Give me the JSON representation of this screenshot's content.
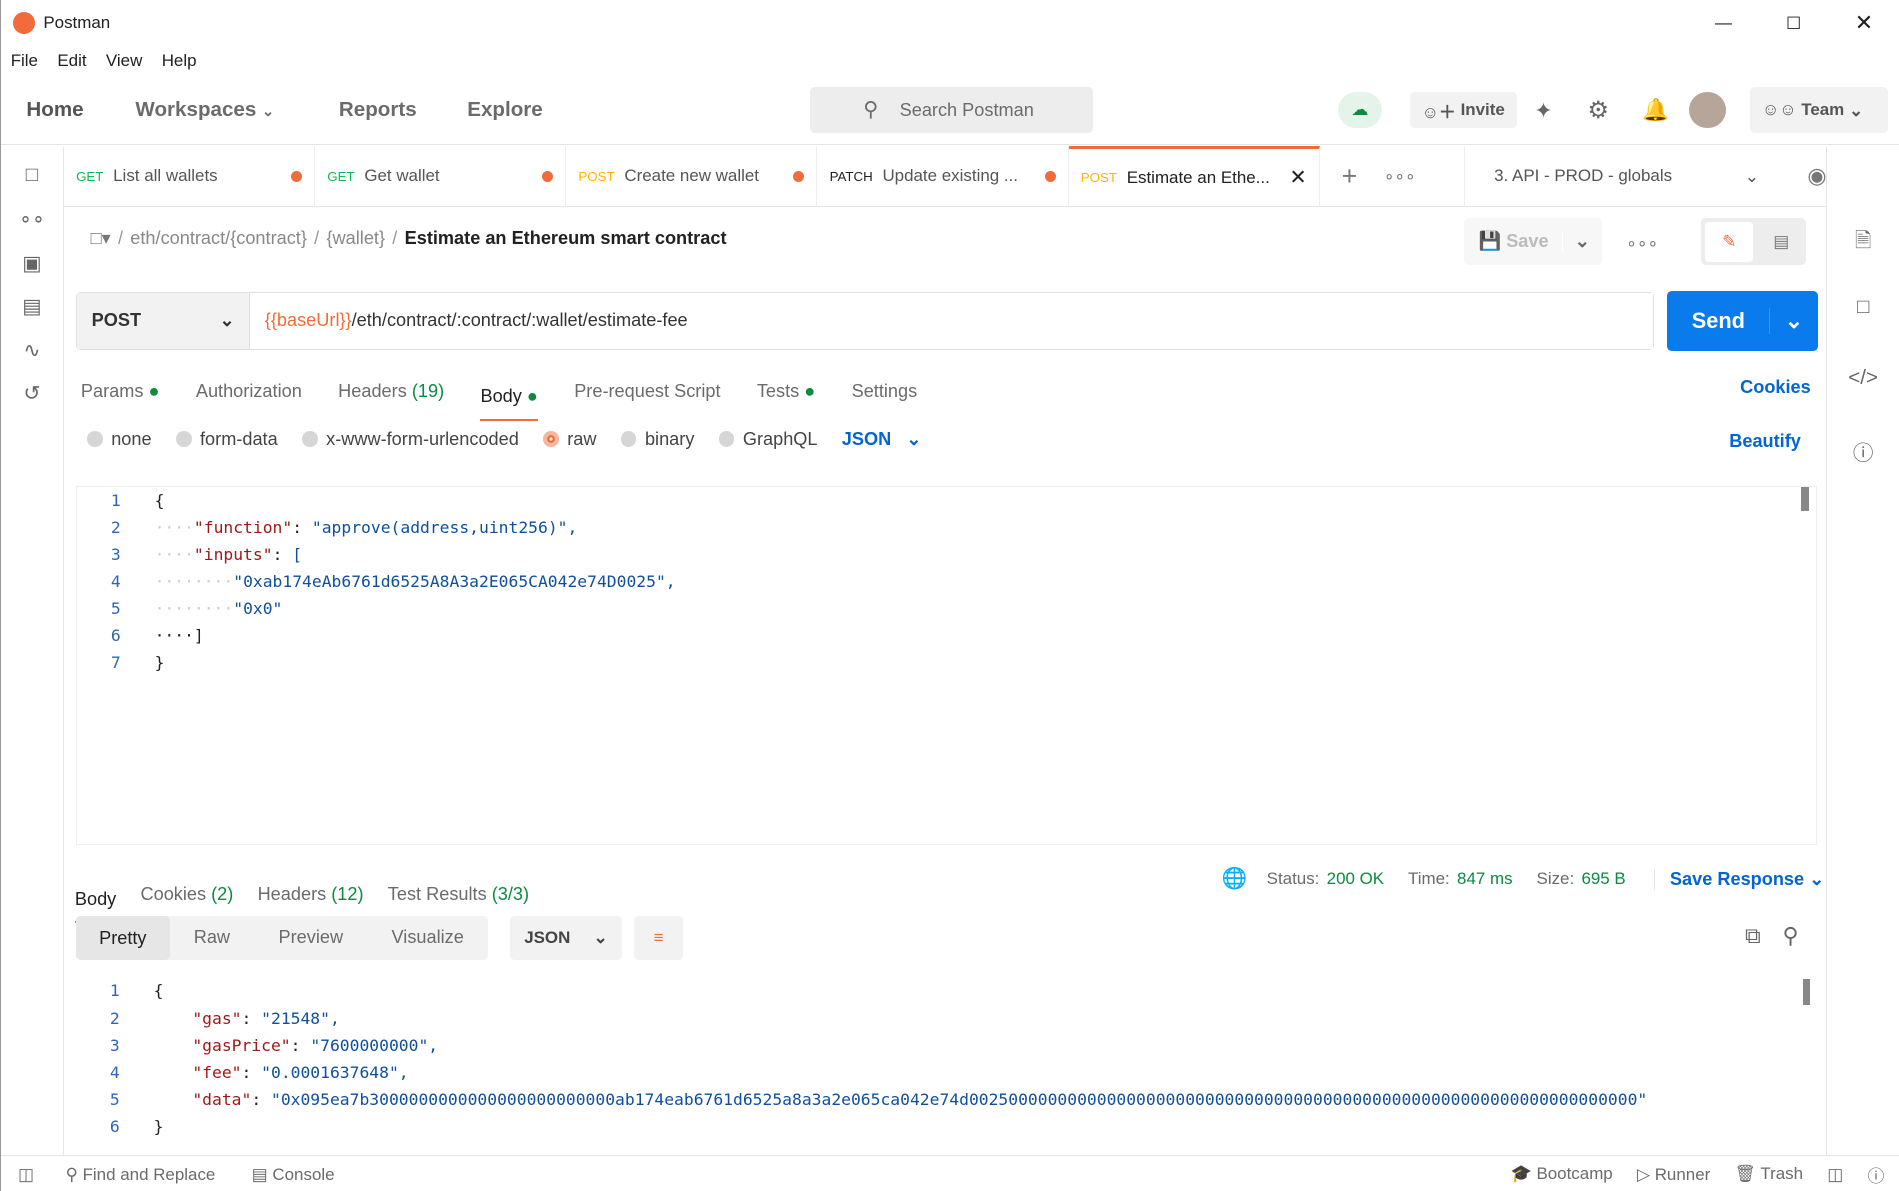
{
  "window": {
    "title": "Postman"
  },
  "menu": [
    "File",
    "Edit",
    "View",
    "Help"
  ],
  "header": {
    "nav": [
      "Home",
      "Workspaces",
      "Reports",
      "Explore"
    ],
    "search_placeholder": "Search Postman",
    "invite": "Invite",
    "team": "Team"
  },
  "tabs": [
    {
      "method": "GET",
      "label": "List all wallets"
    },
    {
      "method": "GET",
      "label": "Get wallet"
    },
    {
      "method": "POST",
      "label": "Create new wallet"
    },
    {
      "method": "PATCH",
      "label": "Update existing ..."
    },
    {
      "method": "POST",
      "label": "Estimate an Ethe..."
    }
  ],
  "environment": "3. API - PROD - globals",
  "breadcrumb": {
    "p1": "eth/contract/{contract}",
    "p2": "{wallet}",
    "current": "Estimate an Ethereum smart contract",
    "sep": "/"
  },
  "toolbar": {
    "save": "Save"
  },
  "request": {
    "method": "POST",
    "url_var": "{{baseUrl}}",
    "url_path": "/eth/contract/:contract/:wallet/estimate-fee",
    "send": "Send"
  },
  "req_tabs": {
    "params": "Params",
    "authorization": "Authorization",
    "headers": "Headers",
    "headers_count": "(19)",
    "body": "Body",
    "prerequest": "Pre-request Script",
    "tests": "Tests",
    "settings": "Settings",
    "cookies": "Cookies"
  },
  "body_types": {
    "none": "none",
    "form_data": "form-data",
    "urlencoded": "x-www-form-urlencoded",
    "raw": "raw",
    "binary": "binary",
    "graphql": "GraphQL",
    "format": "JSON",
    "beautify": "Beautify"
  },
  "request_body": [
    {
      "n": "1",
      "t": "{"
    },
    {
      "n": "2",
      "k": "\"function\"",
      "v": "\"approve(address,uint256)\",",
      "i": "····"
    },
    {
      "n": "3",
      "k": "\"inputs\"",
      "v": "[",
      "i": "····"
    },
    {
      "n": "4",
      "v": "\"0xab174eAb6761d6525A8A3a2E065CA042e74D0025\",",
      "i": "········"
    },
    {
      "n": "5",
      "v": "\"0x0\"",
      "i": "········"
    },
    {
      "n": "6",
      "t": "····]"
    },
    {
      "n": "7",
      "t": "}"
    }
  ],
  "response": {
    "tabs": {
      "body": "Body",
      "cookies": "Cookies",
      "cookies_count": "(2)",
      "headers": "Headers",
      "headers_count": "(12)",
      "tests": "Test Results",
      "tests_count": "(3/3)"
    },
    "status_label": "Status:",
    "status": "200 OK",
    "time_label": "Time:",
    "time": "847 ms",
    "size_label": "Size:",
    "size": "695 B",
    "save": "Save Response",
    "views": [
      "Pretty",
      "Raw",
      "Preview",
      "Visualize"
    ],
    "format": "JSON",
    "body": [
      {
        "n": "1",
        "t": "{"
      },
      {
        "n": "2",
        "k": "\"gas\"",
        "v": "\"21548\","
      },
      {
        "n": "3",
        "k": "\"gasPrice\"",
        "v": "\"7600000000\","
      },
      {
        "n": "4",
        "k": "\"fee\"",
        "v": "\"0.0001637648\","
      },
      {
        "n": "5",
        "k": "\"data\"",
        "v": "\"0x095ea7b3000000000000000000000000ab174eab6761d6525a8a3a2e065ca042e74d00250000000000000000000000000000000000000000000000000000000000000000\""
      },
      {
        "n": "6",
        "t": "}"
      }
    ]
  },
  "footer": {
    "find": "Find and Replace",
    "console": "Console",
    "bootcamp": "Bootcamp",
    "runner": "Runner",
    "trash": "Trash"
  },
  "colors": {
    "accent": "#f26b3a",
    "send": "#097bed",
    "link": "#0265d2",
    "status_ok": "#0a8b3f"
  }
}
